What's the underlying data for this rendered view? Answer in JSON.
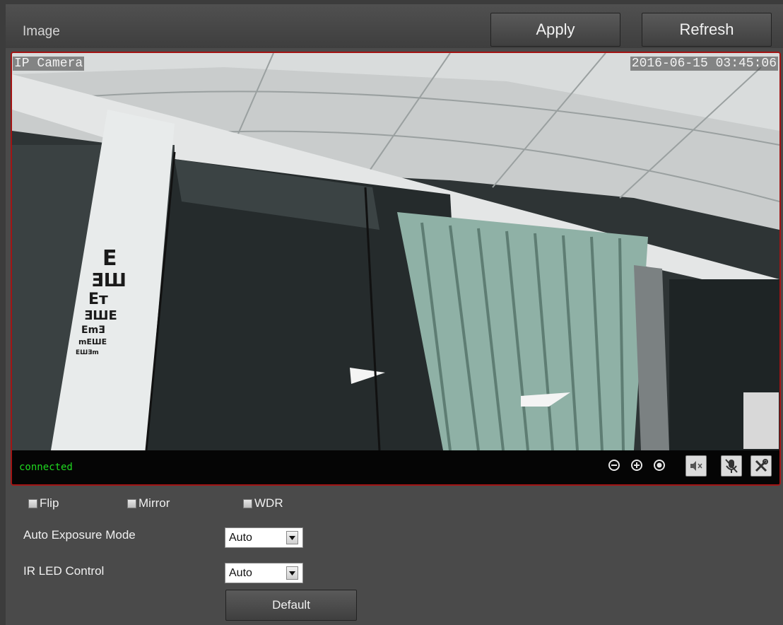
{
  "header": {
    "title": "Image",
    "apply_label": "Apply",
    "refresh_label": "Refresh"
  },
  "viewer": {
    "camera_name": "IP Camera",
    "timestamp": "2016-06-15 03:45:06",
    "status": "connected",
    "controls": [
      "zoom-out-icon",
      "zoom-in-icon",
      "record-icon",
      "mute-speaker-icon",
      "mute-mic-icon",
      "settings-tools-icon"
    ]
  },
  "options": {
    "flip_label": "Flip",
    "mirror_label": "Mirror",
    "wdr_label": "WDR",
    "flip_checked": false,
    "mirror_checked": false,
    "wdr_checked": false,
    "exposure_label": "Auto Exposure Mode",
    "exposure_value": "Auto",
    "irled_label": "IR LED Control",
    "irled_value": "Auto",
    "default_label": "Default"
  },
  "colors": {
    "accent_border": "#a31414",
    "status_green": "#1fd81f",
    "panel_bg": "#4a4a4a"
  }
}
